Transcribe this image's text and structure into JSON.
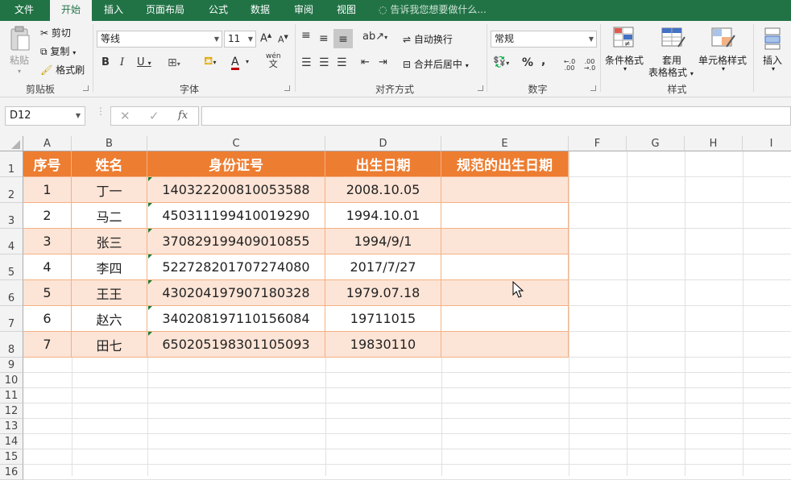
{
  "tabs": [
    {
      "label": "文件",
      "active": false
    },
    {
      "label": "开始",
      "active": true
    },
    {
      "label": "插入",
      "active": false
    },
    {
      "label": "页面布局",
      "active": false
    },
    {
      "label": "公式",
      "active": false
    },
    {
      "label": "数据",
      "active": false
    },
    {
      "label": "审阅",
      "active": false
    },
    {
      "label": "视图",
      "active": false
    }
  ],
  "tell_me": "告诉我您想要做什么...",
  "ribbon": {
    "clipboard": {
      "paste": "粘贴",
      "cut": "剪切",
      "copy": "复制",
      "format_painter": "格式刷",
      "group": "剪贴板"
    },
    "font": {
      "name": "等线",
      "size": "11",
      "group": "字体",
      "wen": "wén",
      "wen_char": "文"
    },
    "alignment": {
      "wrap": "自动换行",
      "merge": "合并后居中",
      "group": "对齐方式"
    },
    "number": {
      "format": "常规",
      "group": "数字",
      "percent": "%",
      "comma": ",",
      "inc_dec": "←.0 .00",
      "dec_dec": ".00 →.0"
    },
    "styles": {
      "conditional": "条件格式",
      "table1": "套用",
      "table2": "表格格式",
      "cell_styles": "单元格样式",
      "group": "样式"
    },
    "cells": {
      "insert": "插入"
    }
  },
  "formula_bar": {
    "name_box": "D12",
    "cancel": "✕",
    "enter": "✓",
    "fx": "fx",
    "content": ""
  },
  "columns": [
    "A",
    "B",
    "C",
    "D",
    "E",
    "F",
    "G",
    "H",
    "I"
  ],
  "rows": [
    "1",
    "2",
    "3",
    "4",
    "5",
    "6",
    "7",
    "8",
    "9",
    "10",
    "11",
    "12",
    "13",
    "14",
    "15",
    "16"
  ],
  "table": {
    "headers": [
      "序号",
      "姓名",
      "身份证号",
      "出生日期",
      "规范的出生日期"
    ],
    "rows": [
      [
        "1",
        "丁一",
        "140322200810053588",
        "2008.10.05",
        ""
      ],
      [
        "2",
        "马二",
        "450311199410019290",
        "1994.10.01",
        ""
      ],
      [
        "3",
        "张三",
        "370829199409010855",
        "1994/9/1",
        ""
      ],
      [
        "4",
        "李四",
        "522728201707274080",
        "2017/7/27",
        ""
      ],
      [
        "5",
        "王王",
        "430204197907180328",
        "1979.07.18",
        ""
      ],
      [
        "6",
        "赵六",
        "340208197110156084",
        "19711015",
        ""
      ],
      [
        "7",
        "田七",
        "650205198301105093",
        "19830110",
        ""
      ]
    ]
  },
  "colors": {
    "ribbon_green": "#217346",
    "header_orange": "#ed7d31",
    "band_peach": "#fce4d6",
    "error_triangle": "#1e7b34"
  }
}
